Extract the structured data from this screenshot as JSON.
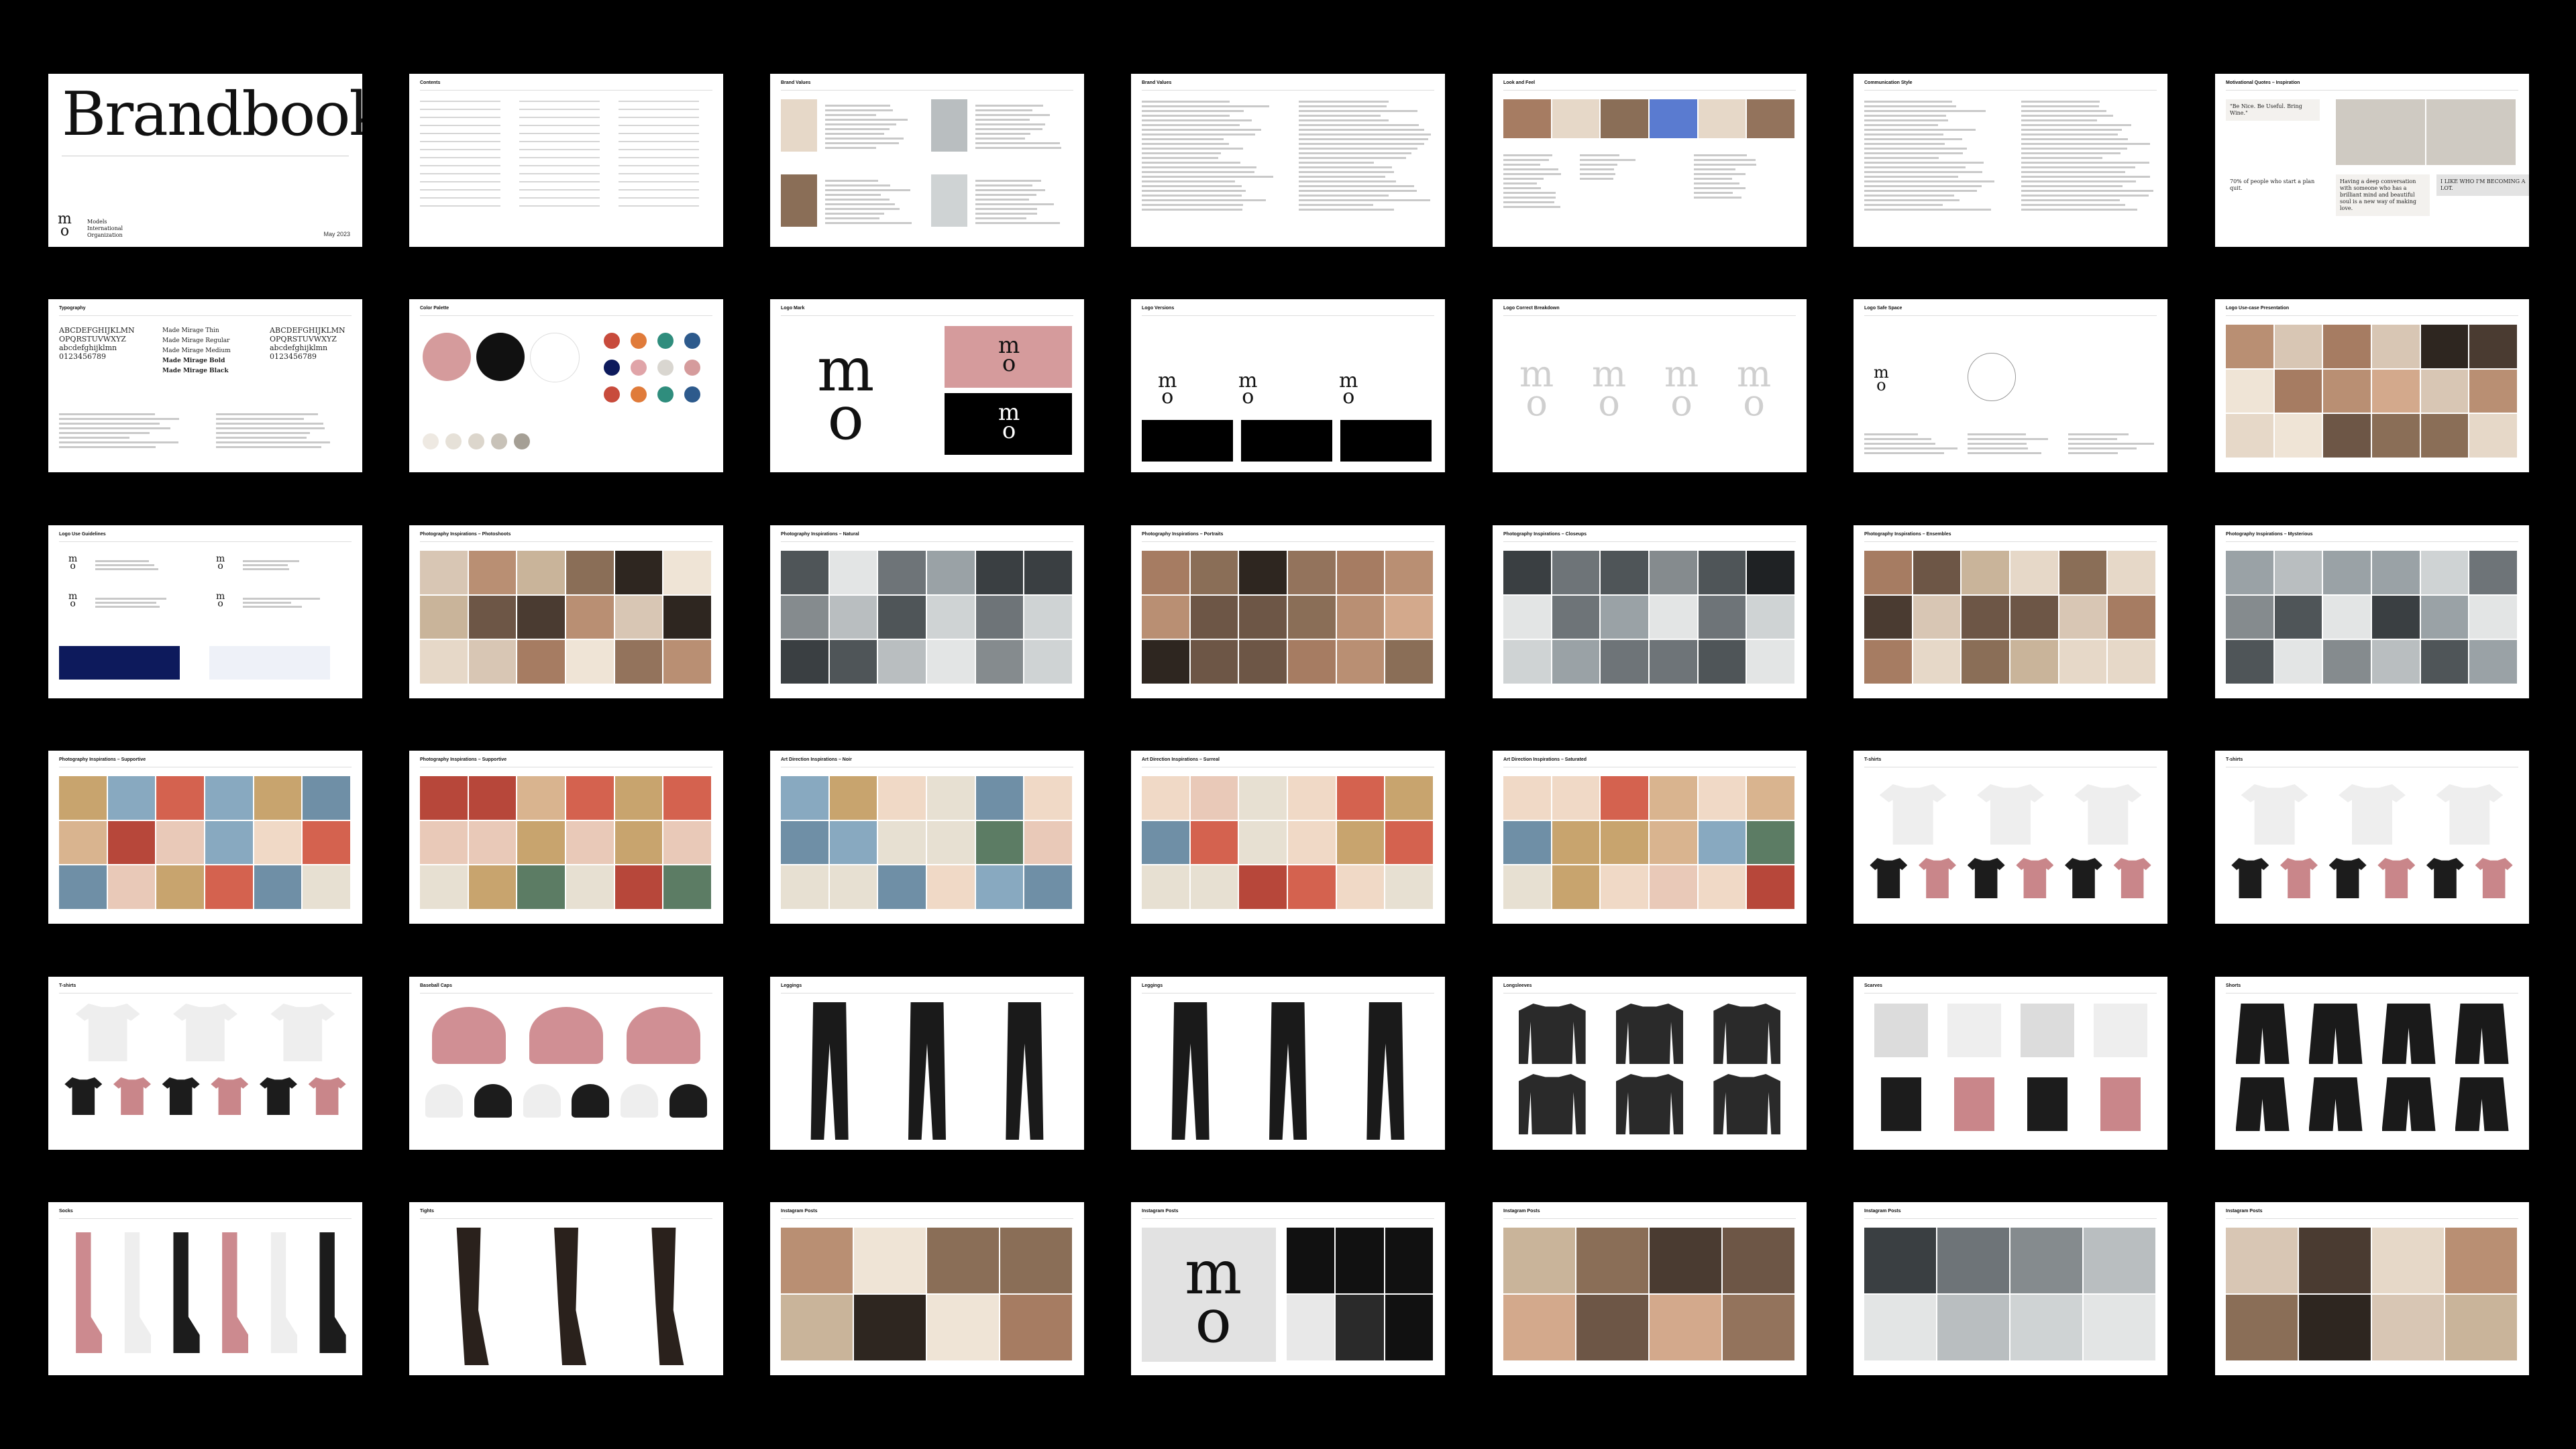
{
  "cover": {
    "title": "Brandbook",
    "org_line1": "Models",
    "org_line2": "International",
    "org_line3": "Organization",
    "date": "May 2023"
  },
  "slides": [
    {
      "title": "",
      "kind": "cover"
    },
    {
      "title": "Contents",
      "kind": "contents"
    },
    {
      "title": "Brand Values",
      "kind": "values"
    },
    {
      "title": "Brand Values",
      "kind": "text"
    },
    {
      "title": "Look and Feel",
      "kind": "look"
    },
    {
      "title": "Communication Style",
      "kind": "text"
    },
    {
      "title": "Motivational Quotes – Inspiration",
      "kind": "quotes"
    },
    {
      "title": "Typography",
      "kind": "typography"
    },
    {
      "title": "Color Palette",
      "kind": "palette"
    },
    {
      "title": "Logo Mark",
      "kind": "logomark"
    },
    {
      "title": "Logo Versions",
      "kind": "logoversions"
    },
    {
      "title": "Logo Correct Breakdown",
      "kind": "breakdown"
    },
    {
      "title": "Logo Safe Space",
      "kind": "safespace"
    },
    {
      "title": "Logo Use-case Presentation",
      "kind": "photos"
    },
    {
      "title": "Logo Use Guidelines",
      "kind": "guidelines"
    },
    {
      "title": "Photography Inspirations – Photoshoots",
      "kind": "photos"
    },
    {
      "title": "Photography Inspirations – Natural",
      "kind": "photos"
    },
    {
      "title": "Photography Inspirations – Portraits",
      "kind": "photos"
    },
    {
      "title": "Photography Inspirations – Closeups",
      "kind": "photos"
    },
    {
      "title": "Photography Inspirations – Ensembles",
      "kind": "photos"
    },
    {
      "title": "Photography Inspirations – Mysterious",
      "kind": "photos"
    },
    {
      "title": "Photography Inspirations – Supportive",
      "kind": "photos"
    },
    {
      "title": "Photography Inspirations – Supportive",
      "kind": "photos"
    },
    {
      "title": "Art Direction Inspirations – Noir",
      "kind": "photos"
    },
    {
      "title": "Art Direction Inspirations – Surreal",
      "kind": "photos"
    },
    {
      "title": "Art Direction Inspirations – Saturated",
      "kind": "photos"
    },
    {
      "title": "T-shirts",
      "kind": "tshirts"
    },
    {
      "title": "T-shirts",
      "kind": "tshirts"
    },
    {
      "title": "T-shirts",
      "kind": "tshirts3"
    },
    {
      "title": "Baseball Caps",
      "kind": "caps"
    },
    {
      "title": "Leggings",
      "kind": "leggings"
    },
    {
      "title": "Leggings",
      "kind": "leggings"
    },
    {
      "title": "Longsleeves",
      "kind": "longsleeves"
    },
    {
      "title": "Scarves",
      "kind": "scarves"
    },
    {
      "title": "Shorts",
      "kind": "shorts"
    },
    {
      "title": "Socks",
      "kind": "socks"
    },
    {
      "title": "Tights",
      "kind": "tights"
    },
    {
      "title": "Instagram Posts",
      "kind": "photos"
    },
    {
      "title": "Instagram Posts",
      "kind": "instalogo"
    },
    {
      "title": "Instagram Posts",
      "kind": "photos"
    },
    {
      "title": "Instagram Posts",
      "kind": "photos"
    },
    {
      "title": "Instagram Posts",
      "kind": "photos"
    }
  ],
  "quotes": {
    "q1": "\"Be Nice. Be Useful. Bring Wine.\"",
    "q2": "70% of people who start a plan quit.",
    "q3": "Having a deep conversation with someone who has a brilliant mind and beautiful soul is a new way of making love.",
    "q4": "I LIKE WHO I'M BECOMING A LOT."
  },
  "typography": {
    "sample": "ABCDEFGHIJKLMN OPQRSTUVWXYZ abcdefghijklmn 0123456789",
    "weights": [
      "Made Mirage Thin",
      "Made Mirage Regular",
      "Made Mirage Medium",
      "Made Mirage Bold",
      "Made Mirage Black"
    ]
  },
  "logo": {
    "glyph": "m",
    "glyph2": "o"
  },
  "colors": {
    "pink": "#d59b9c",
    "black": "#111111",
    "white": "#ffffff",
    "red": "#c84b3c",
    "orange": "#e07b3a",
    "teal": "#2f8d7d",
    "blue": "#2d5a8c",
    "navy": "#0d1a5c",
    "rose": "#e0a4a8",
    "grey": "#d9d6d0"
  }
}
